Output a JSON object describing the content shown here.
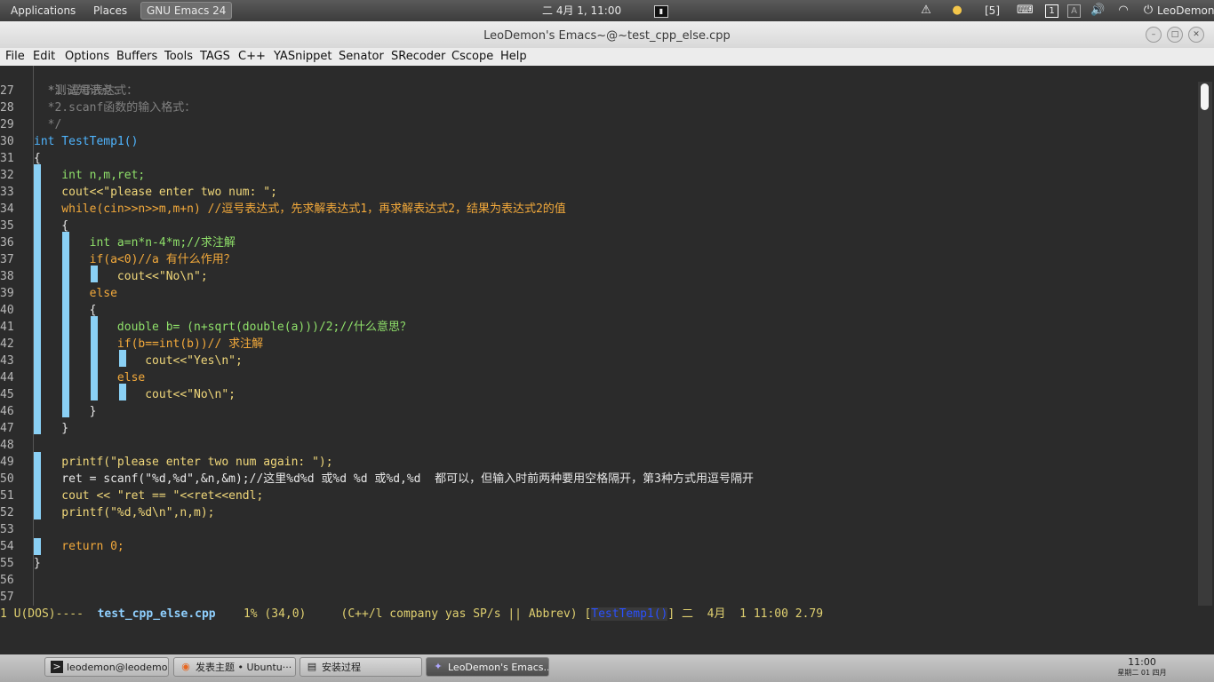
{
  "top_panel": {
    "applications": "Applications",
    "places": "Places",
    "active_task": "GNU Emacs 24",
    "clock": "二 4月  1, 11:00",
    "workspace_count": "[5]",
    "user": "LeoDemon",
    "workspace_number": "1"
  },
  "window": {
    "title": "LeoDemon's Emacs~@~test_cpp_else.cpp"
  },
  "menu": [
    "File",
    "Edit",
    "Options",
    "Buffers",
    "Tools",
    "TAGS",
    "C++",
    "YASnippet",
    "Senator",
    "SRecoder",
    "Cscope",
    "Help"
  ],
  "editor": {
    "header_comment": "  *测试知识点：",
    "lines": [
      {
        "num": "27",
        "text": "  *1.逗号表达式："
      },
      {
        "num": "28",
        "text": "  *2.scanf函数的输入格式："
      },
      {
        "num": "29",
        "text": "  */"
      },
      {
        "num": "30",
        "text": "int TestTemp1()"
      },
      {
        "num": "31",
        "text": "{"
      },
      {
        "num": "32",
        "text": "    int n,m,ret;"
      },
      {
        "num": "33",
        "text": "    cout<<\"please enter two num: \";"
      },
      {
        "num": "34",
        "text": "    while(cin>>n>>m,m+n) //逗号表达式，先求解表达式1，再求解表达式2，结果为表达式2的值"
      },
      {
        "num": "35",
        "text": "    {"
      },
      {
        "num": "36",
        "text": "        int a=n*n-4*m;//求注解"
      },
      {
        "num": "37",
        "text": "        if(a<0)//a 有什么作用？"
      },
      {
        "num": "38",
        "text": "            cout<<\"No\\n\";"
      },
      {
        "num": "39",
        "text": "        else"
      },
      {
        "num": "40",
        "text": "        {"
      },
      {
        "num": "41",
        "text": "            double b= (n+sqrt(double(a)))/2;//什么意思？"
      },
      {
        "num": "42",
        "text": "            if(b==int(b))// 求注解"
      },
      {
        "num": "43",
        "text": "                cout<<\"Yes\\n\";"
      },
      {
        "num": "44",
        "text": "            else"
      },
      {
        "num": "45",
        "text": "                cout<<\"No\\n\";"
      },
      {
        "num": "46",
        "text": "        }"
      },
      {
        "num": "47",
        "text": "    }"
      },
      {
        "num": "48",
        "text": ""
      },
      {
        "num": "49",
        "text": "    printf(\"please enter two num again: \");"
      },
      {
        "num": "50",
        "text": "    ret = scanf(\"%d,%d\",&n,&m);//这里%d%d 或%d %d 或%d,%d  都可以，但输入时前两种要用空格隔开，第3种方式用逗号隔开"
      },
      {
        "num": "51",
        "text": "    cout << \"ret == \"<<ret<<endl;"
      },
      {
        "num": "52",
        "text": "    printf(\"%d,%d\\n\",n,m);"
      },
      {
        "num": "53",
        "text": ""
      },
      {
        "num": "54",
        "text": "    return 0;"
      },
      {
        "num": "55",
        "text": "}"
      },
      {
        "num": "56",
        "text": ""
      },
      {
        "num": "57",
        "text": ""
      }
    ]
  },
  "mode_line": {
    "status": "1 U(DOS)----  ",
    "buffer_name": "test_cpp_else.cpp",
    "position": "    1% (34,0)     (C++/l company yas SP/s || Abbrev) [",
    "function": "TestTemp1()",
    "rest": "] 二  4月  1 11:00 2.79"
  },
  "taskbar": {
    "tasks": [
      {
        "label": "leodemon@leodemo...",
        "icon": "terminal-icon"
      },
      {
        "label": "发表主题 • Ubuntu···",
        "icon": "firefox-icon"
      },
      {
        "label": "安装过程",
        "icon": "document-icon"
      },
      {
        "label": "LeoDemon's Emacs...",
        "icon": "emacs-icon"
      }
    ],
    "clock_time": "11:00",
    "clock_date": "星期二 01 四月"
  },
  "colors": {
    "editor_bg": "#2b2b2b",
    "guide": "#8ad0f5",
    "keyword": "#f2a93b",
    "type": "#8fe06a",
    "string": "#f0d77a",
    "comment": "#808080",
    "function_name": "#4fb5ff"
  }
}
